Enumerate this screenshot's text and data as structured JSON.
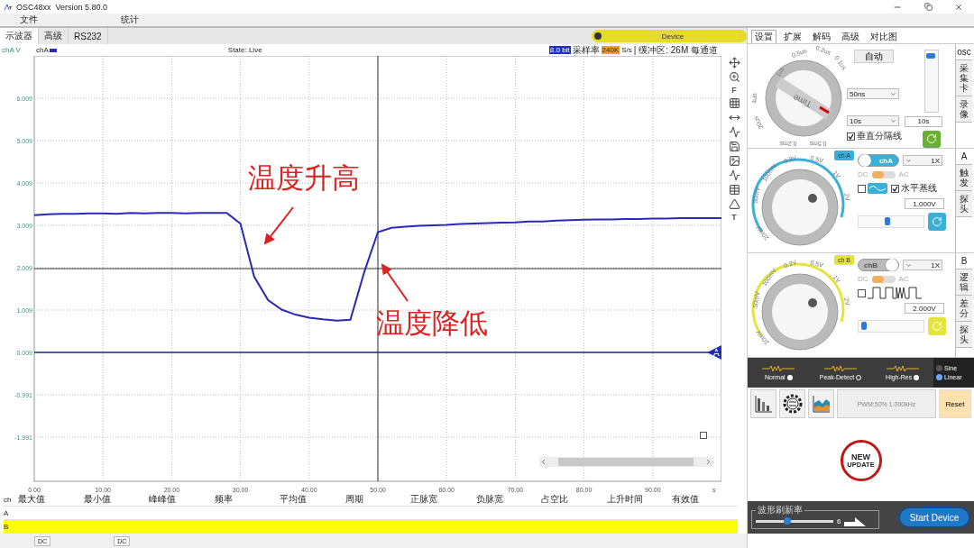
{
  "window": {
    "title": "OSC48xx  Version 5.80.0"
  },
  "menu": [
    {
      "label": "文件"
    },
    {
      "label": "统计"
    }
  ],
  "tabs": [
    {
      "label": "示波器",
      "selected": true
    },
    {
      "label": "高级",
      "selected": false
    },
    {
      "label": "RS232",
      "selected": false
    }
  ],
  "device_button": {
    "label": "Device",
    "on": true
  },
  "scope": {
    "state": "State: Live",
    "bits": "8.0 bit",
    "sample_label": "采样率",
    "sample_rate": "240K",
    "sample_unit": "S/s",
    "buffer": "| 缓冲区: 26M 每通道",
    "toolbar_letters": [
      "F",
      "T"
    ],
    "chart_data": {
      "type": "line",
      "grid": true,
      "ylabel": "chA V",
      "xlabel": "s",
      "x": [
        0,
        2,
        4,
        6,
        8,
        10,
        12,
        14,
        16,
        18,
        20,
        22,
        24,
        26,
        28,
        30,
        32,
        34,
        36,
        38,
        40,
        42,
        44,
        46,
        48,
        50,
        52,
        54,
        56,
        58,
        60,
        62,
        64,
        66,
        68,
        70,
        72,
        74,
        76,
        78,
        80,
        82,
        84,
        86,
        88,
        90,
        92,
        94,
        96,
        98,
        100
      ],
      "series": [
        {
          "name": "chA",
          "color": "#2a2ab8",
          "values": [
            3.25,
            3.27,
            3.28,
            3.28,
            3.29,
            3.29,
            3.28,
            3.3,
            3.29,
            3.3,
            3.3,
            3.29,
            3.3,
            3.3,
            3.3,
            3.05,
            1.8,
            1.25,
            1.02,
            0.9,
            0.83,
            0.79,
            0.76,
            0.78,
            1.9,
            2.85,
            2.95,
            2.98,
            3.0,
            3.01,
            3.02,
            3.04,
            3.05,
            3.06,
            3.07,
            3.08,
            3.1,
            3.1,
            3.12,
            3.13,
            3.14,
            3.15,
            3.15,
            3.16,
            3.16,
            3.17,
            3.17,
            3.18,
            3.18,
            3.18,
            3.18
          ]
        },
        {
          "name": "A",
          "color": "#1a2a80",
          "values": [
            0.009,
            0.009,
            0.009,
            0.009,
            0.009,
            0.009,
            0.009,
            0.009,
            0.009,
            0.009,
            0.009,
            0.009,
            0.009,
            0.009,
            0.009,
            0.009,
            0.009,
            0.009,
            0.009,
            0.009,
            0.009,
            0.009,
            0.009,
            0.009,
            0.009,
            0.009,
            0.009,
            0.009,
            0.009,
            0.009,
            0.009,
            0.009,
            0.009,
            0.009,
            0.009,
            0.009,
            0.009,
            0.009,
            0.009,
            0.009,
            0.009,
            0.009,
            0.009,
            0.009,
            0.009,
            0.009,
            0.009,
            0.009,
            0.009,
            0.009,
            0.009
          ]
        }
      ],
      "xlim": [
        0,
        100
      ],
      "ylim": [
        -3.034,
        7.009
      ],
      "xticks": [
        {
          "value": 0,
          "label": "0.00"
        },
        {
          "value": 10,
          "label": "10.00"
        },
        {
          "value": 20,
          "label": "20.00"
        },
        {
          "value": 30,
          "label": "30.00"
        },
        {
          "value": 40,
          "label": "40.00"
        },
        {
          "value": 50,
          "label": "50.00"
        },
        {
          "value": 60,
          "label": "60.00"
        },
        {
          "value": 70,
          "label": "70.00"
        },
        {
          "value": 80,
          "label": "80.00"
        },
        {
          "value": 90,
          "label": "90.00"
        }
      ],
      "yticks": [
        {
          "value": 6.009,
          "label": "6.009"
        },
        {
          "value": 5.009,
          "label": "5.009"
        },
        {
          "value": 4.009,
          "label": "4.009"
        },
        {
          "value": 3.009,
          "label": "3.009"
        },
        {
          "value": 2.009,
          "label": "2.009"
        },
        {
          "value": 1.009,
          "label": "1.009"
        },
        {
          "value": 0.009,
          "label": "0.009"
        },
        {
          "value": -0.991,
          "label": "-0.991"
        },
        {
          "value": -1.991,
          "label": "-1.991"
        }
      ],
      "annotations": [
        {
          "text": "温度升高"
        },
        {
          "text": "温度降低"
        }
      ]
    }
  },
  "measurements": {
    "columns": [
      "ch",
      "最大值",
      "最小值",
      "峰峰值",
      "频率",
      "平均值",
      "周期",
      "正脉宽",
      "负脉宽",
      "占空比",
      "上升时间",
      "有效值"
    ],
    "rows": [
      {
        "ch": "A",
        "highlighted": false
      },
      {
        "ch": "B",
        "highlighted": true
      }
    ]
  },
  "status_bar": [
    {
      "label": "DC"
    },
    {
      "label": "DC"
    }
  ],
  "panel": {
    "tabs": [
      {
        "label": "设置",
        "selected": true
      },
      {
        "label": "扩展",
        "selected": false
      },
      {
        "label": "解码",
        "selected": false
      },
      {
        "label": "高级",
        "selected": false
      },
      {
        "label": "对比图",
        "selected": false
      }
    ],
    "timebase": {
      "knob_labels": [
        "1us",
        "0.5us",
        "0.2us",
        "0.1us",
        "4us",
        "20us",
        "0.2ms",
        "0.5ms"
      ],
      "knob_title": "Time",
      "auto": "自动",
      "time_div": "50ns",
      "duration": "10s",
      "duration_field": "10s",
      "divider": {
        "label": "垂直分隔线",
        "checked": true
      },
      "level": 0.95,
      "side_tabs": [
        {
          "label": "osc",
          "selected": true
        },
        {
          "label": "采集卡",
          "selected": false
        },
        {
          "label": "录像",
          "selected": false
        }
      ]
    },
    "channels": [
      {
        "name": "chA",
        "tag": "ch A",
        "color": "#3ab0d8",
        "on": true,
        "probe": "1X",
        "dc": "DC",
        "ac": "AC",
        "ac_coupled": false,
        "knob_labels": [
          "50mV",
          "100mV",
          "0.2V",
          "0.5V",
          "1V",
          "2V",
          "20mV"
        ],
        "options": [
          {
            "kind": "wave",
            "checked": false
          },
          {
            "kind": "label",
            "label": "水平基线",
            "checked": true
          }
        ],
        "offset": "1.000V",
        "level": 0.45,
        "side_tabs": [
          {
            "label": "A",
            "selected": true
          },
          {
            "label": "触发",
            "selected": false
          },
          {
            "label": "探头",
            "selected": false
          }
        ]
      },
      {
        "name": "chB",
        "tag": "ch B",
        "color": "#e4e43c",
        "on": false,
        "probe": "1X",
        "dc": "DC",
        "ac": "AC",
        "ac_coupled": false,
        "knob_labels": [
          "50mV",
          "100mV",
          "0.2V",
          "0.5V",
          "1V",
          "2V",
          "20mV"
        ],
        "options": [
          {
            "kind": "pulse",
            "checked": false
          }
        ],
        "offset": "2.000V",
        "level": 0.05,
        "side_tabs": [
          {
            "label": "B",
            "selected": true
          },
          {
            "label": "逻辑",
            "selected": false
          },
          {
            "label": "差分",
            "selected": false
          },
          {
            "label": "探头",
            "selected": false
          }
        ]
      }
    ],
    "modes": [
      {
        "label": "Normal",
        "selected": false
      },
      {
        "label": "Peak-Detect",
        "selected": true
      },
      {
        "label": "High-Res",
        "selected": false
      }
    ],
    "waveforms": [
      {
        "label": "Sine",
        "selected": false
      },
      {
        "label": "Linear",
        "selected": true
      }
    ],
    "pwm": {
      "label": "PWM:50% 1.000kHz",
      "disabled": true
    },
    "reset": "Reset",
    "update_badge": {
      "line1": "NEW",
      "line2": "UPDATE"
    },
    "refresh": {
      "label": "波形刷新率",
      "value": "6",
      "level": 0.4
    },
    "start": "Start Device"
  }
}
